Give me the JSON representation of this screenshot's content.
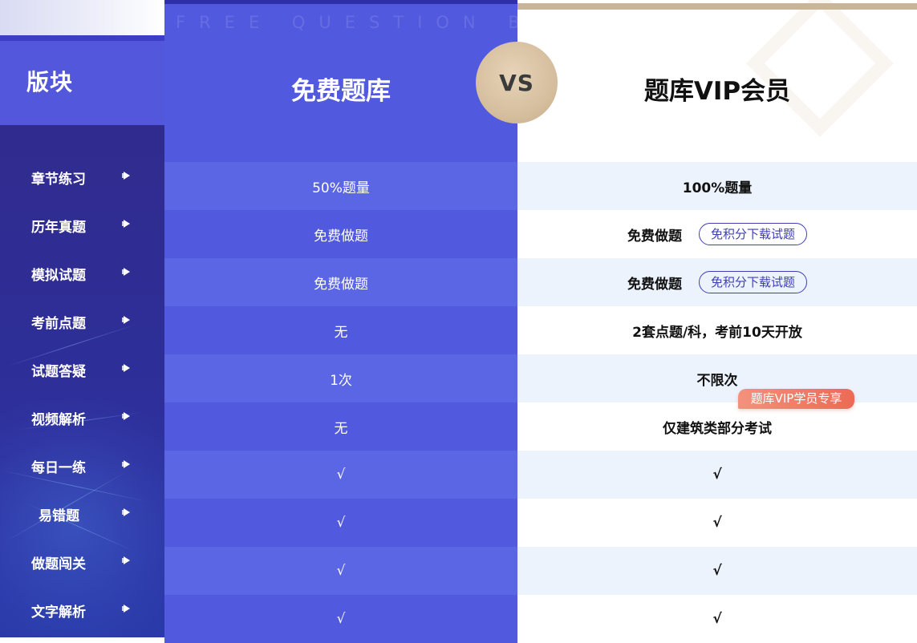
{
  "header": {
    "watermark": "FREE QUESTION BANK",
    "row_header": "版块",
    "free_title": "免费题库",
    "vs": "VS",
    "vip_title": "题库VIP会员"
  },
  "rows": [
    {
      "label": "章节练习",
      "free": "50%题量",
      "vip": "100%题量",
      "pill": ""
    },
    {
      "label": "历年真题",
      "free": "免费做题",
      "vip": "免费做题",
      "pill": "免积分下载试题"
    },
    {
      "label": "模拟试题",
      "free": "免费做题",
      "vip": "免费做题",
      "pill": "免积分下载试题"
    },
    {
      "label": "考前点题",
      "free": "无",
      "vip": "2套点题/科，考前10天开放",
      "pill": ""
    },
    {
      "label": "试题答疑",
      "free": "1次",
      "vip": "不限次",
      "pill": ""
    },
    {
      "label": "视频解析",
      "free": "无",
      "vip": "仅建筑类部分考试",
      "pill": ""
    },
    {
      "label": "每日一练",
      "free": "√",
      "vip": "√",
      "pill": ""
    },
    {
      "label": "易错题",
      "free": "√",
      "vip": "√",
      "pill": ""
    },
    {
      "label": "做题闯关",
      "free": "√",
      "vip": "√",
      "pill": ""
    },
    {
      "label": "文字解析",
      "free": "√",
      "vip": "√",
      "pill": ""
    }
  ],
  "vip_badge": "题库VIP学员专享",
  "colors": {
    "free_base": "#5159df",
    "free_alt": "#5b66e4",
    "vip_alt": "#ecf3fd",
    "left_dark": "#302b8e",
    "gold": "#c8b497",
    "badge": "#ec6a55"
  },
  "icons": {
    "row_arrow": "play-arrow-icon"
  }
}
